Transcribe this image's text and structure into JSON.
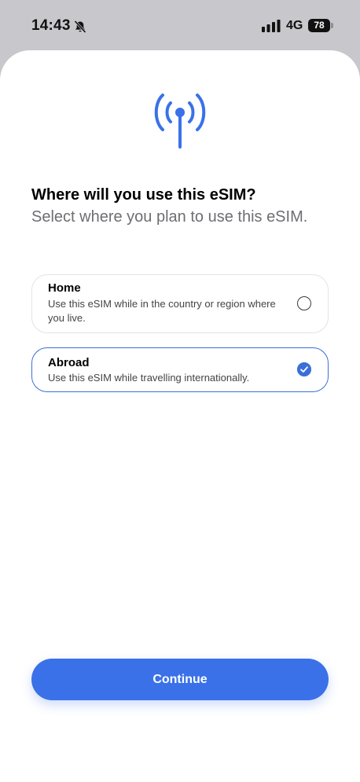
{
  "status_bar": {
    "time": "14:43",
    "network": "4G",
    "battery": "78",
    "icons": [
      "bell-slash-icon",
      "signal-bars-icon",
      "battery-icon"
    ]
  },
  "header": {
    "icon": "antenna-icon",
    "title": "Where will you use this eSIM?",
    "subtitle": "Select where you plan to use this eSIM."
  },
  "options": [
    {
      "title": "Home",
      "description": "Use this eSIM while in the country or region where you live.",
      "selected": false
    },
    {
      "title": "Abroad",
      "description": "Use this eSIM while travelling internationally.",
      "selected": true
    }
  ],
  "footer": {
    "continue_label": "Continue"
  },
  "colors": {
    "accent": "#3a71e8",
    "selected_border": "#3a6fd8",
    "backdrop": "#c7c7cc"
  }
}
